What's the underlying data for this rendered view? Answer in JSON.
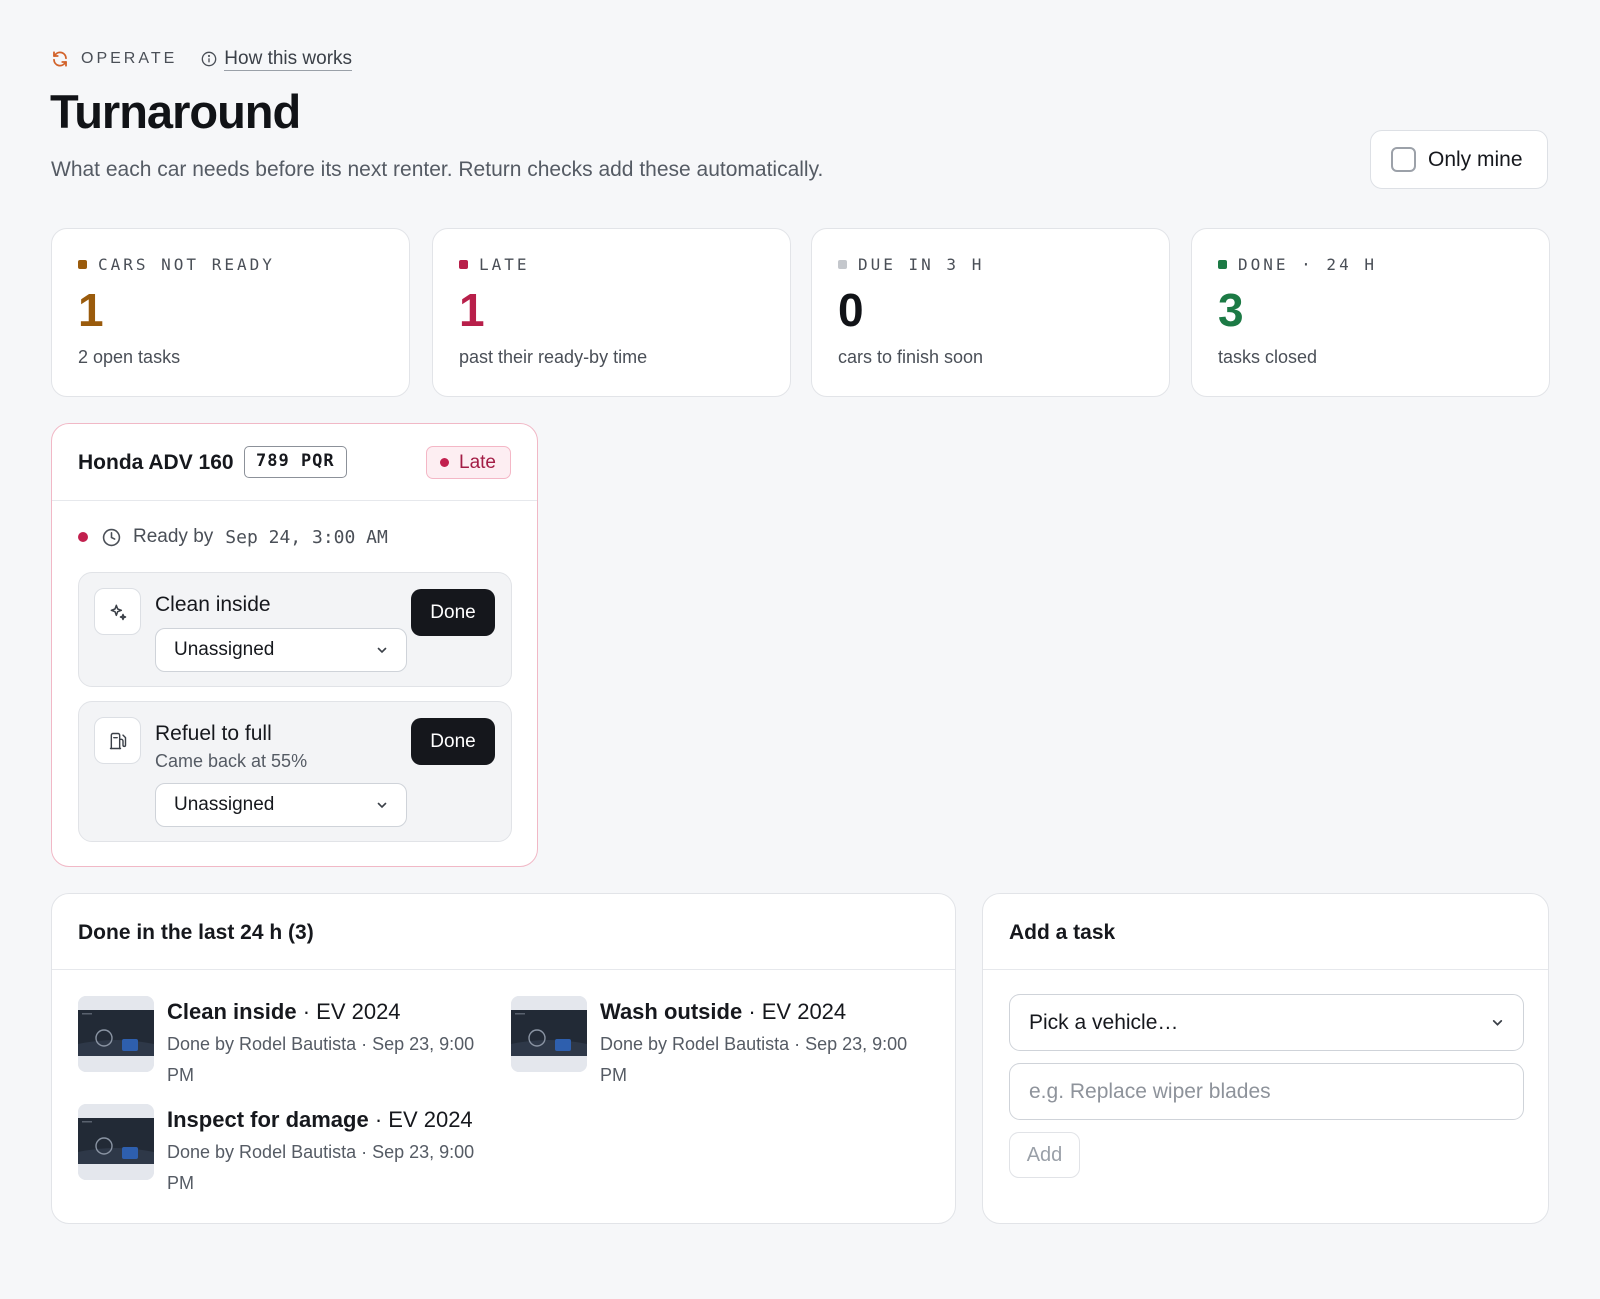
{
  "header": {
    "section": "OPERATE",
    "how_link": "How this works",
    "title": "Turnaround",
    "subtitle": "What each car needs before its next renter. Return checks add these automatically.",
    "only_mine_label": "Only mine",
    "only_mine_checked": false
  },
  "stats": [
    {
      "label": "CARS NOT READY",
      "value": "1",
      "desc": "2 open tasks",
      "color": "#9a5b0c"
    },
    {
      "label": "LATE",
      "value": "1",
      "desc": "past their ready-by time",
      "color": "#b81f4a"
    },
    {
      "label": "DUE IN 3 H",
      "value": "0",
      "desc": "cars to finish soon",
      "color": "#111317",
      "dot_color": "#c4c7cc"
    },
    {
      "label": "DONE · 24 H",
      "value": "3",
      "desc": "tasks closed",
      "color": "#1c7a45"
    }
  ],
  "vehicle": {
    "name": "Honda ADV 160",
    "plate": "789 PQR",
    "status": "Late",
    "ready_label": "Ready by",
    "ready_time": "Sep 24, 3:00 AM",
    "tasks": [
      {
        "icon": "sparkle-icon",
        "name": "Clean inside",
        "note": "",
        "assignee": "Unassigned",
        "done_label": "Done"
      },
      {
        "icon": "fuel-pump-icon",
        "name": "Refuel to full",
        "note": "Came back at 55%",
        "assignee": "Unassigned",
        "done_label": "Done"
      }
    ]
  },
  "done_panel": {
    "title": "Done in the last 24 h (3)",
    "items": [
      {
        "task": "Clean inside",
        "vehicle": " · EV 2024",
        "meta": "Done by Rodel Bautista · Sep 23, 9:00 PM"
      },
      {
        "task": "Wash outside",
        "vehicle": " · EV 2024",
        "meta": "Done by Rodel Bautista · Sep 23, 9:00 PM"
      },
      {
        "task": "Inspect for damage",
        "vehicle": " · EV 2024",
        "meta": "Done by Rodel Bautista · Sep 23, 9:00 PM"
      }
    ]
  },
  "add_task": {
    "title": "Add a task",
    "vehicle_select": "Pick a vehicle…",
    "task_placeholder": "e.g. Replace wiper blades",
    "add_label": "Add"
  }
}
